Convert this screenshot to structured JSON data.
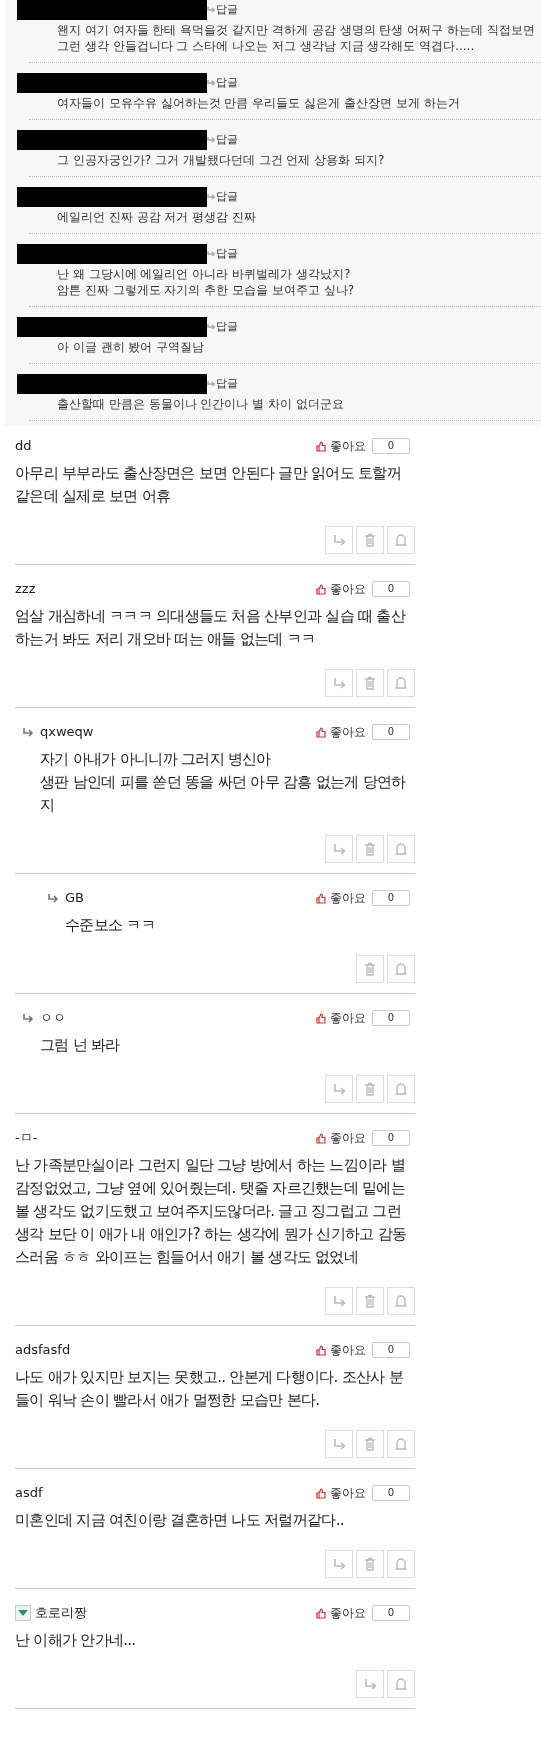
{
  "replies_panel": {
    "items": [
      {
        "reply_label": "답글",
        "text": "왠지 여기 여자들 한테 욕먹을것 같지만 격하게 공감 생명의 탄생 어쩌구 하는데 직접보면\n그런 생각 안들겁니다 그 스타에 나오는 저그 생각남 지금 생각해도 역겹다....."
      },
      {
        "reply_label": "답글",
        "text": "여자들이 모유수유 싫어하는것 만큼 우리들도 싫은게 출산장면 보게 하는거"
      },
      {
        "reply_label": "답글",
        "text": "그 인공자궁인가? 그거 개발됐다던데 그건 언제 상용화 되지?"
      },
      {
        "reply_label": "답글",
        "text": "에일리언 진짜 공감 저거 평생감 진짜"
      },
      {
        "reply_label": "답글",
        "text": "난 왜 그당시에 에일리언 아니라 바퀴벌레가 생각났지?\n암튼 진짜 그렇게도 자기의 추한 모습을 보여주고 싶나?"
      },
      {
        "reply_label": "답글",
        "text": "아 이글 괜히 봤어 구역질남"
      },
      {
        "reply_label": "답글",
        "text": "출산할때 만큼은 동물이나 인간이나 별 차이 없더군요"
      }
    ]
  },
  "comments": [
    {
      "name": "dd",
      "member_icon": false,
      "like_label": "좋아요",
      "likes": "0",
      "text": "아무리 부부라도 출산장면은 보면 안된다 글만 읽어도 토할꺼같은데 실제로 보면 어휴",
      "actions": [
        {
          "kind": "reply"
        },
        {
          "kind": "delete"
        },
        {
          "kind": "report"
        }
      ]
    },
    {
      "name": "zzz",
      "member_icon": false,
      "like_label": "좋아요",
      "likes": "0",
      "text": "엄살 개심하네 ㅋㅋㅋ 의대생들도 처음 산부인과 실습 때 출산하는거 봐도 저리 개오바 떠는 애들 없는데 ㅋㅋ",
      "actions": [
        {
          "kind": "reply"
        },
        {
          "kind": "delete"
        },
        {
          "kind": "report"
        }
      ],
      "children": [
        {
          "name": "qxweqw",
          "member_icon": false,
          "like_label": "좋아요",
          "likes": "0",
          "text": "자기 아내가 아니니까 그러지 병신아\n생판 남인데 피를 쏟던 똥을 싸던 아무 감흥 없는게 당연하지",
          "actions": [
            {
              "kind": "reply"
            },
            {
              "kind": "delete"
            },
            {
              "kind": "report"
            }
          ],
          "children": [
            {
              "name": "GB",
              "member_icon": false,
              "like_label": "좋아요",
              "likes": "0",
              "text": "수준보소 ㅋㅋ",
              "actions": [
                {
                  "kind": "delete"
                },
                {
                  "kind": "report"
                }
              ]
            }
          ]
        },
        {
          "name": "ㅇㅇ",
          "member_icon": false,
          "like_label": "좋아요",
          "likes": "0",
          "text": "그럼 넌 봐라",
          "actions": [
            {
              "kind": "reply"
            },
            {
              "kind": "delete"
            },
            {
              "kind": "report"
            }
          ]
        }
      ]
    },
    {
      "name": "-ㅁ-",
      "member_icon": false,
      "like_label": "좋아요",
      "likes": "0",
      "text": "난 가족분만실이라 그런지 일단 그냥 방에서 하는 느낌이라 별 감정없었고, 그냥 옆에 있어줬는데. 탯줄 자르긴했는데 밑에는 볼 생각도 없기도했고 보여주지도않더라. 글고 징그럽고 그런 생각 보단 이 애가 내 애인가? 하는 생각에 뭔가 신기하고 감동스러움 ㅎㅎ 와이프는 힘들어서 애기 볼 생각도 없었네",
      "actions": [
        {
          "kind": "reply"
        },
        {
          "kind": "delete"
        },
        {
          "kind": "report"
        }
      ]
    },
    {
      "name": "adsfasfd",
      "member_icon": false,
      "like_label": "좋아요",
      "likes": "0",
      "text": "나도 애가 있지만 보지는 못했고.. 안본게 다행이다. 조산사 분들이 워낙 손이 빨라서 애가 멀쩡한 모습만 본다.",
      "actions": [
        {
          "kind": "reply"
        },
        {
          "kind": "delete"
        },
        {
          "kind": "report"
        }
      ]
    },
    {
      "name": "asdf",
      "member_icon": false,
      "like_label": "좋아요",
      "likes": "0",
      "text": "미혼인데 지금 여친이랑 결혼하면 나도 저럴꺼같다..",
      "actions": [
        {
          "kind": "reply"
        },
        {
          "kind": "delete"
        },
        {
          "kind": "report"
        }
      ]
    },
    {
      "name": "호로리짱",
      "member_icon": true,
      "like_label": "좋아요",
      "likes": "0",
      "text": "난 이해가 안가네...",
      "actions": [
        {
          "kind": "reply"
        },
        {
          "kind": "report"
        }
      ]
    }
  ]
}
